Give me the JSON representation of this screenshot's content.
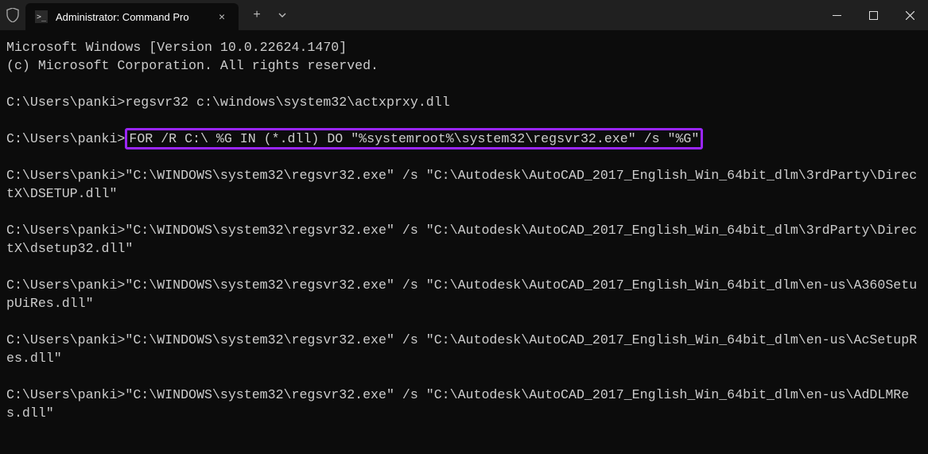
{
  "titlebar": {
    "tab_title": "Administrator: Command Pro"
  },
  "terminal": {
    "line1": "Microsoft Windows [Version 10.0.22624.1470]",
    "line2": "(c) Microsoft Corporation. All rights reserved.",
    "blank": "",
    "prompt1": "C:\\Users\\panki>",
    "cmd1": "regsvr32 c:\\windows\\system32\\actxprxy.dll",
    "prompt2": "C:\\Users\\panki>",
    "cmd2_highlight": "FOR /R C:\\ %G IN (*.dll) DO \"%systemroot%\\system32\\regsvr32.exe\" /s \"%G\"",
    "out1": "C:\\Users\\panki>\"C:\\WINDOWS\\system32\\regsvr32.exe\" /s \"C:\\Autodesk\\AutoCAD_2017_English_Win_64bit_dlm\\3rdParty\\DirectX\\DSETUP.dll\"",
    "out2": "C:\\Users\\panki>\"C:\\WINDOWS\\system32\\regsvr32.exe\" /s \"C:\\Autodesk\\AutoCAD_2017_English_Win_64bit_dlm\\3rdParty\\DirectX\\dsetup32.dll\"",
    "out3": "C:\\Users\\panki>\"C:\\WINDOWS\\system32\\regsvr32.exe\" /s \"C:\\Autodesk\\AutoCAD_2017_English_Win_64bit_dlm\\en-us\\A360SetupUiRes.dll\"",
    "out4": "C:\\Users\\panki>\"C:\\WINDOWS\\system32\\regsvr32.exe\" /s \"C:\\Autodesk\\AutoCAD_2017_English_Win_64bit_dlm\\en-us\\AcSetupRes.dll\"",
    "out5": "C:\\Users\\panki>\"C:\\WINDOWS\\system32\\regsvr32.exe\" /s \"C:\\Autodesk\\AutoCAD_2017_English_Win_64bit_dlm\\en-us\\AdDLMRes.dll\""
  }
}
